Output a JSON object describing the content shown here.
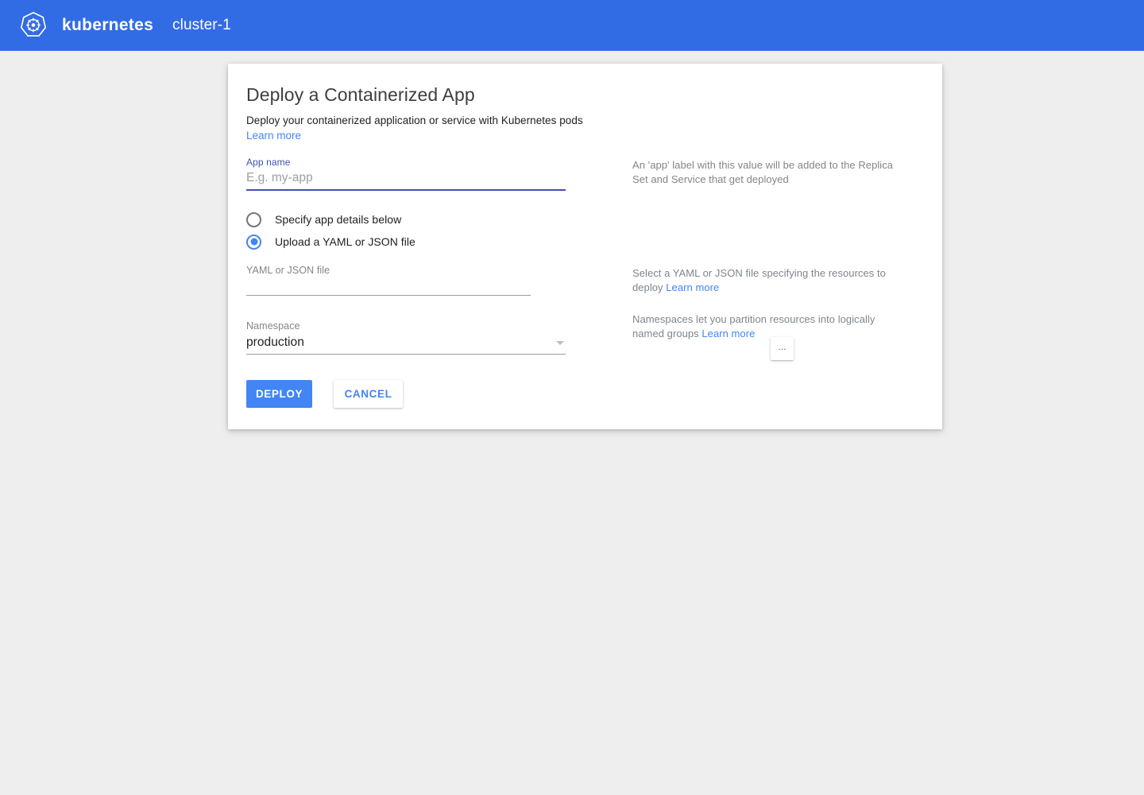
{
  "header": {
    "logo_icon": "kubernetes-helm-icon",
    "brand": "kubernetes",
    "cluster": "cluster-1",
    "background_color": "#326ce5"
  },
  "card": {
    "title": "Deploy a Containerized App",
    "description": "Deploy your containerized application or service  with Kubernetes pods",
    "description_link": "Learn more"
  },
  "form": {
    "app_name": {
      "label": "App name",
      "value": "",
      "placeholder": "E.g. my-app",
      "help": "An 'app' label with this value will be added to the Replica Set and Service that get deployed",
      "focused": true
    },
    "source_options": [
      {
        "label": "Specify app details below",
        "selected": false
      },
      {
        "label": "Upload a YAML or JSON file",
        "selected": true
      }
    ],
    "file": {
      "label": "YAML or JSON file",
      "value": "",
      "browse_label": "...",
      "help_text": "Select a YAML or JSON file specifying the  resources to deploy",
      "help_link": "Learn more"
    },
    "namespace": {
      "label": "Namespace",
      "value": "production",
      "caret_icon": "chevron-down-icon",
      "help_text": "Namespaces let you partition resources into logically named groups",
      "help_link": "Learn more"
    }
  },
  "actions": {
    "deploy_label": "DEPLOY",
    "cancel_label": "CANCEL",
    "primary_color": "#4285f4"
  }
}
